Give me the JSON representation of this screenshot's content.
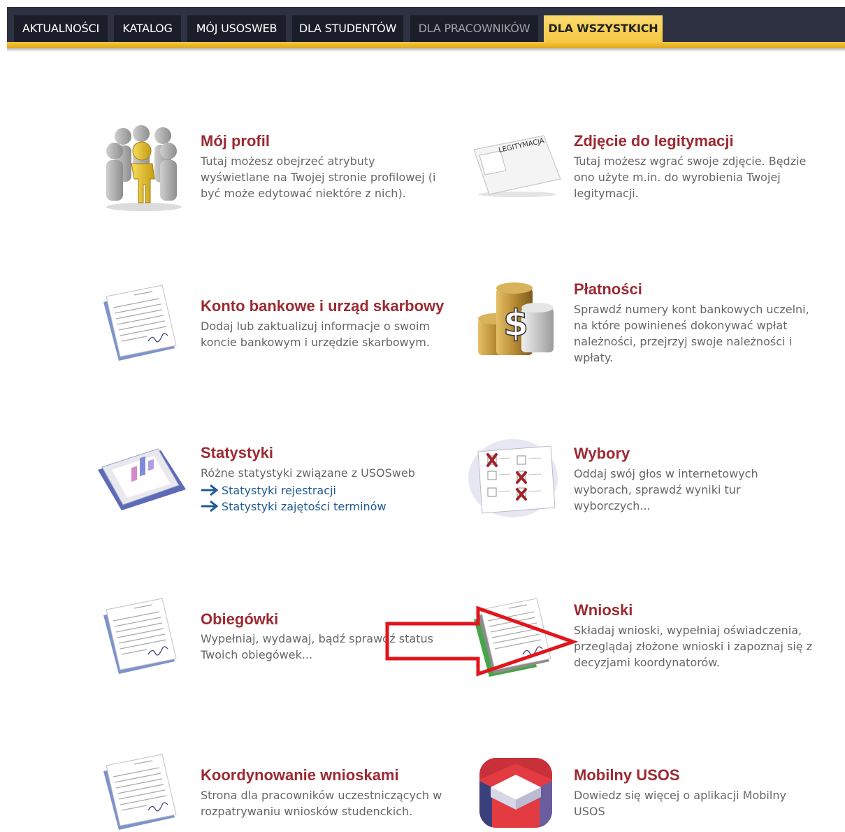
{
  "nav": {
    "tabs": [
      {
        "label": "AKTUALNOŚCI"
      },
      {
        "label": "KATALOG"
      },
      {
        "label": "MÓJ USOSWEB"
      },
      {
        "label": "DLA STUDENTÓW"
      },
      {
        "label": "DLA PRACOWNIKÓW"
      },
      {
        "label": "DLA WSZYSTKICH"
      }
    ],
    "active_tab": "DLA WSZYSTKICH"
  },
  "tiles": {
    "moj_profil": {
      "title": "Mój profil",
      "desc": [
        "Tutaj możesz obejrzeć atrybuty",
        "wyświetlane na Twojej stronie profilowej (i",
        "być może edytować niektóre z nich)."
      ],
      "icon": "people-icon"
    },
    "zdjecie": {
      "title": "Zdjęcie do legitymacji",
      "desc": [
        "Tutaj możesz wgrać swoje zdjęcie. Będzie",
        "ono użyte m.in. do wyrobienia Twojej",
        "legitymacji."
      ],
      "icon": "id-card-icon",
      "icon_text": "LEGITYMACJA"
    },
    "konto": {
      "title": "Konto bankowe i urząd skarbowy",
      "desc": [
        "Dodaj lub zaktualizuj informacje o swoim",
        "koncie bankowym i urzędzie skarbowym."
      ],
      "icon": "document-icon"
    },
    "platnosci": {
      "title": "Płatności",
      "desc": [
        "Sprawdź numery kont bankowych uczelni,",
        "na które powinieneś dokonywać wpłat",
        "należności, przejrzyj swoje należności i",
        "wpłaty."
      ],
      "icon": "coins-dollar-icon",
      "icon_text": "$"
    },
    "statystyki": {
      "title": "Statystyki",
      "desc": [
        "Różne statystyki związane z USOSweb"
      ],
      "links": [
        "Statystyki rejestracji",
        "Statystyki zajętości terminów"
      ],
      "icon": "chart-icon"
    },
    "wybory": {
      "title": "Wybory",
      "desc": [
        "Oddaj swój głos w internetowych",
        "wyborach, sprawdź wyniki tur",
        "wyborczych..."
      ],
      "icon": "ballot-icon"
    },
    "obiegowki": {
      "title": "Obiegówki",
      "desc": [
        "Wypełniaj, wydawaj, bądź sprawdź status",
        "Twoich obiegówek..."
      ],
      "icon": "document-icon"
    },
    "wnioski": {
      "title": "Wnioski",
      "desc": [
        "Składaj wnioski, wypełniaj oświadczenia,",
        "przeglądaj złożone wnioski i zapoznaj się z",
        "decyzjami koordynatorów."
      ],
      "icon": "document-stack-icon"
    },
    "koordynowanie": {
      "title": "Koordynowanie wnioskami",
      "desc": [
        "Strona dla pracowników uczestniczących w",
        "rozpatrywaniu wniosków studenckich."
      ],
      "icon": "document-icon"
    },
    "mobilny": {
      "title": "Mobilny USOS",
      "desc": [
        "Dowiedz się więcej o aplikacji Mobilny",
        "USOS"
      ],
      "icon": "mobile-usos-icon"
    }
  },
  "annotation": {
    "type": "arrow",
    "color": "#e3141b",
    "points_to": "Wnioski"
  },
  "colors": {
    "nav_bg": "#2d3142",
    "tab_bg": "#1b1e28",
    "accent": "#f3c742",
    "title": "#9c2a32",
    "link": "#1f5a95"
  }
}
